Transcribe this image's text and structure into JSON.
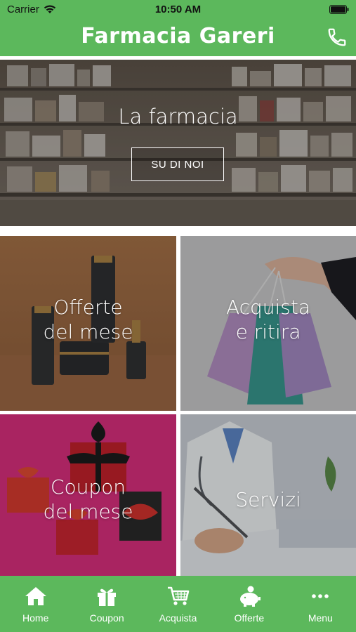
{
  "status_bar": {
    "carrier": "Carrier",
    "time": "10:50 AM"
  },
  "header": {
    "title": "Farmacia Gareri",
    "icon": "phone-icon"
  },
  "hero": {
    "title": "La farmacia",
    "button_label": "SU DI NOI"
  },
  "tiles": [
    {
      "line1": "Offerte",
      "line2": "del mese"
    },
    {
      "line1": "Acquista",
      "line2": "e ritira"
    },
    {
      "line1": "Coupon",
      "line2": "del mese"
    },
    {
      "line1": "Servizi"
    }
  ],
  "tabs": [
    {
      "label": "Home",
      "icon": "home-icon"
    },
    {
      "label": "Coupon",
      "icon": "gift-icon"
    },
    {
      "label": "Acquista",
      "icon": "cart-icon"
    },
    {
      "label": "Offerte",
      "icon": "piggy-bank-icon"
    },
    {
      "label": "Menu",
      "icon": "more-icon"
    }
  ],
  "colors": {
    "brand": "#5cb85c"
  }
}
